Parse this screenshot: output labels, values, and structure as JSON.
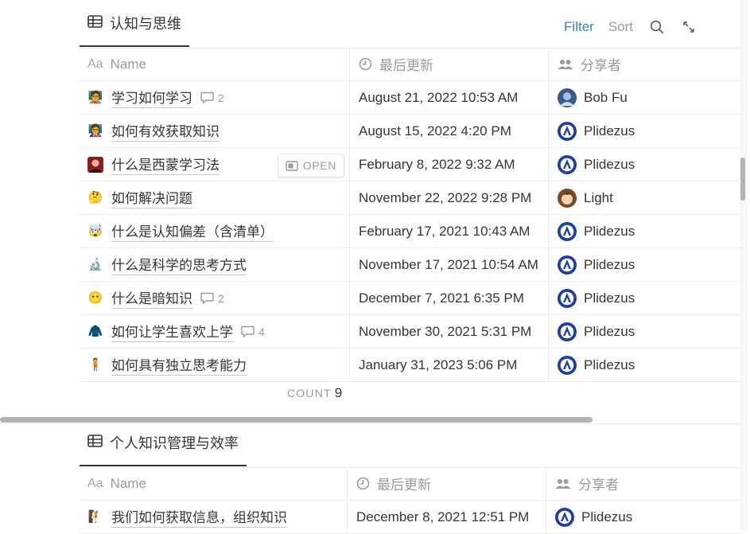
{
  "colors": {
    "accent": "#2f80d1",
    "text": "#37352f",
    "muted": "#9b9a97",
    "divider": "#ededec"
  },
  "toolbar": {
    "filter_label": "Filter",
    "sort_label": "Sort"
  },
  "db1": {
    "view_name": "认知与思维",
    "headers": {
      "name": "Name",
      "name_prefix": "Aa",
      "updated": "最后更新",
      "shared_by": "分享者"
    },
    "rows": [
      {
        "icon": "student-emoji-icon",
        "glyph": "🧑‍🏫",
        "title": "学习如何学习",
        "comments": "2",
        "updated": "August 21, 2022 10:53 AM",
        "user": "Bob Fu",
        "avatar": "bob-fu-avatar"
      },
      {
        "icon": "teacher-emoji-icon",
        "glyph": "👩‍🏫",
        "title": "如何有效获取知识",
        "comments": "",
        "updated": "August 15, 2022 4:20 PM",
        "user": "Plidezus",
        "avatar": "plidezus-avatar"
      },
      {
        "icon": "portrait-image-icon",
        "glyph": "",
        "title": "什么是西蒙学习法",
        "comments": "",
        "updated": "February 8, 2022 9:32 AM",
        "user": "Plidezus",
        "avatar": "plidezus-avatar",
        "open_label": "OPEN"
      },
      {
        "icon": "thinking-face-icon",
        "glyph": "🤔",
        "title": "如何解决问题",
        "comments": "",
        "updated": "November 22, 2022 9:28 PM",
        "user": "Light",
        "avatar": "light-avatar"
      },
      {
        "icon": "exploding-head-icon",
        "glyph": "🤯",
        "title": "什么是认知偏差（含清单）",
        "comments": "",
        "updated": "February 17, 2021 10:43 AM",
        "user": "Plidezus",
        "avatar": "plidezus-avatar"
      },
      {
        "icon": "microscope-icon",
        "glyph": "🔬",
        "title": "什么是科学的思考方式",
        "comments": "",
        "updated": "November 17, 2021 10:54 AM",
        "user": "Plidezus",
        "avatar": "plidezus-avatar"
      },
      {
        "icon": "dark-face-icon",
        "glyph": "😶",
        "title": "什么是暗知识",
        "comments": "2",
        "updated": "December 7, 2021 6:35 PM",
        "user": "Plidezus",
        "avatar": "plidezus-avatar"
      },
      {
        "icon": "red-sweater-icon",
        "glyph": "🧥",
        "title": "如何让学生喜欢上学",
        "comments": "4",
        "updated": "November 30, 2021 5:31 PM",
        "user": "Plidezus",
        "avatar": "plidezus-avatar"
      },
      {
        "icon": "person-standing-icon",
        "glyph": "🧍",
        "title": "如何具有独立思考能力",
        "comments": "",
        "updated": "January 31, 2023 5:06 PM",
        "user": "Plidezus",
        "avatar": "plidezus-avatar"
      }
    ],
    "count_label": "COUNT",
    "count_value": "9"
  },
  "db2": {
    "view_name": "个人知识管理与效率",
    "headers": {
      "name": "Name",
      "name_prefix": "Aa",
      "updated": "最后更新",
      "shared_by": "分享者"
    },
    "rows": [
      {
        "icon": "person-with-flag-icon",
        "glyph": "🧗",
        "title": "我们如何获取信息，组织知识",
        "comments": "",
        "updated": "December 8, 2021 12:51 PM",
        "user": "Plidezus",
        "avatar": "plidezus-avatar"
      }
    ]
  }
}
